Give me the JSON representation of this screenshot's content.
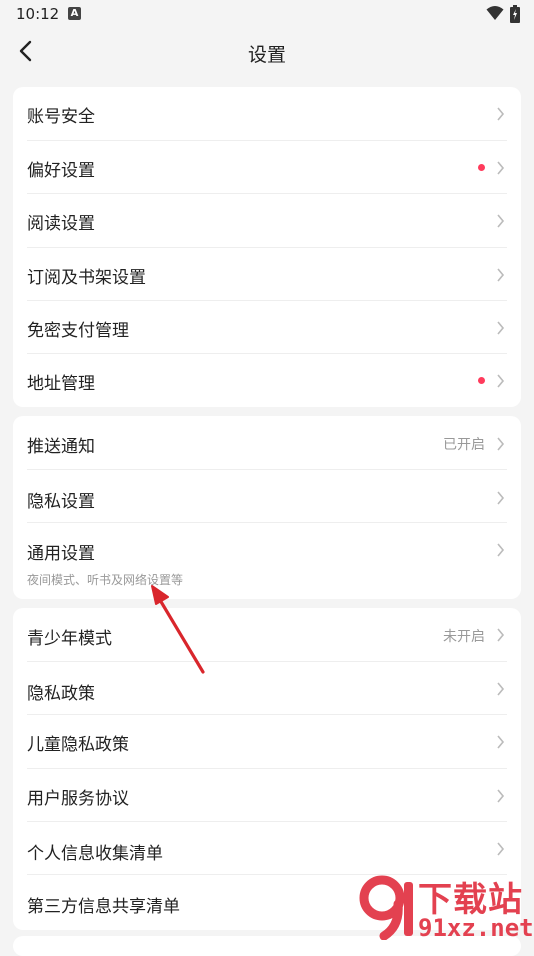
{
  "status_bar": {
    "time": "10:12",
    "notif_glyph": "A"
  },
  "header": {
    "title": "设置"
  },
  "groups": [
    {
      "items": [
        {
          "label": "账号安全"
        },
        {
          "label": "偏好设置",
          "badge": "red-dot"
        },
        {
          "label": "阅读设置"
        },
        {
          "label": "订阅及书架设置"
        },
        {
          "label": "免密支付管理"
        },
        {
          "label": "地址管理",
          "badge": "red-dot"
        }
      ]
    },
    {
      "items": [
        {
          "label": "推送通知",
          "value": "已开启"
        },
        {
          "label": "隐私设置"
        },
        {
          "label": "通用设置",
          "sub": "夜间模式、听书及网络设置等"
        }
      ]
    },
    {
      "items": [
        {
          "label": "青少年模式",
          "value": "未开启"
        },
        {
          "label": "隐私政策"
        },
        {
          "label": "儿童隐私政策"
        },
        {
          "label": "用户服务协议"
        },
        {
          "label": "个人信息收集清单"
        },
        {
          "label": "第三方信息共享清单"
        }
      ]
    }
  ],
  "watermark": {
    "top": "下载站",
    "bottom": "91xz.net"
  },
  "colors": {
    "accent_dot": "#ff3b5c",
    "watermark": "#e34150",
    "arrow": "#d9262c"
  }
}
